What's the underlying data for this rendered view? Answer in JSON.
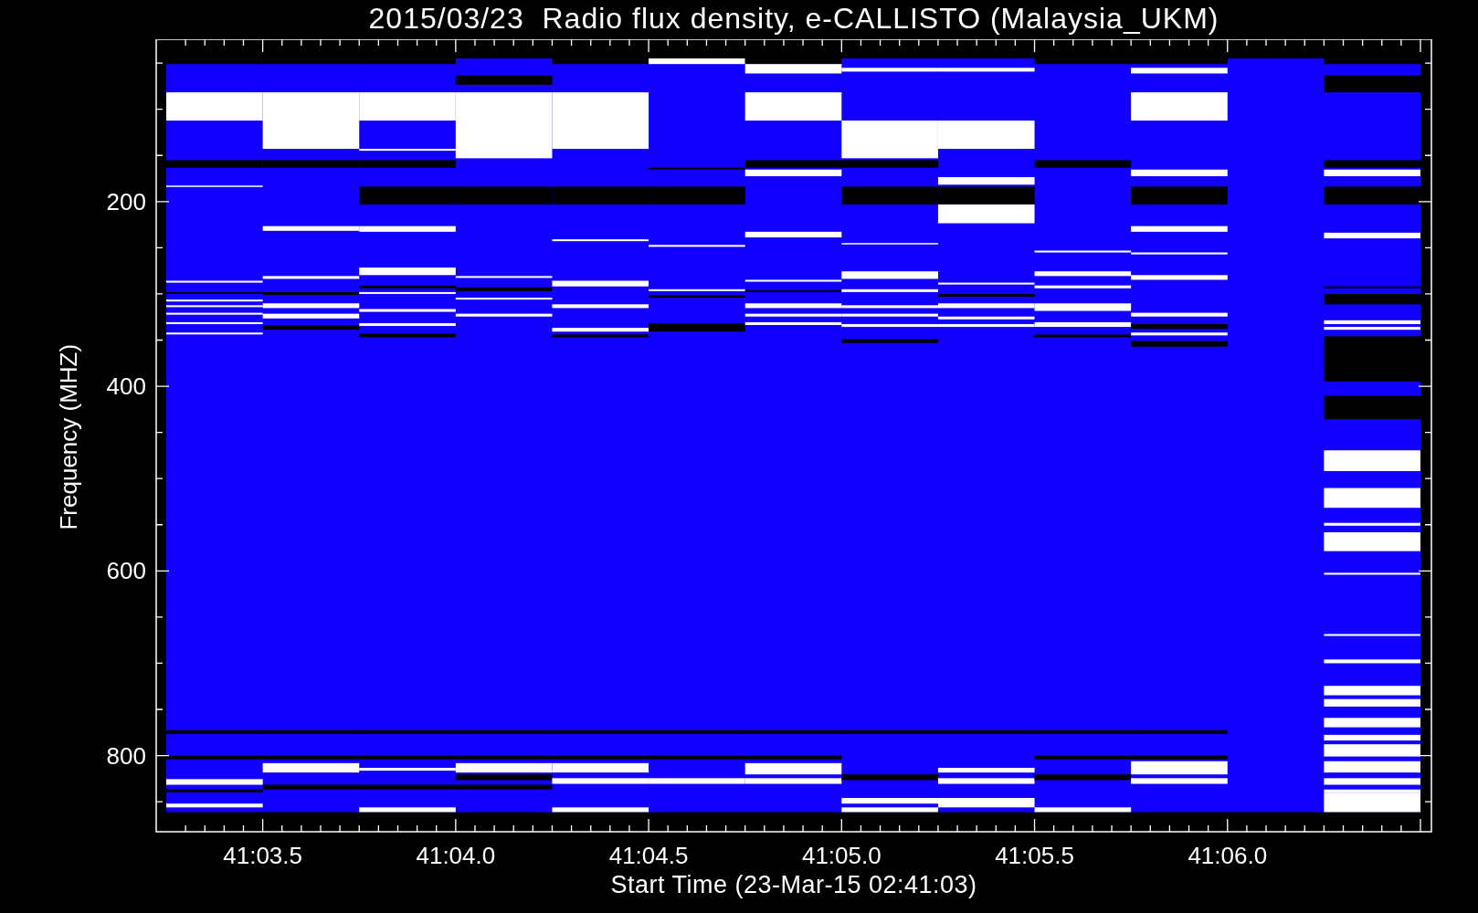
{
  "plot": {
    "title": "2015/03/23  Radio flux density, e-CALLISTO (Malaysia_UKM)",
    "ylabel": "Frequency (MHZ)",
    "xlabel": "Start Time (23-Mar-15 02:41:03)",
    "ytick_labels": [
      "200",
      "400",
      "600",
      "800"
    ],
    "xtick_labels": [
      "41:03.5",
      "41:04.0",
      "41:04.5",
      "41:05.0",
      "41:05.5",
      "41:06.0"
    ]
  }
}
